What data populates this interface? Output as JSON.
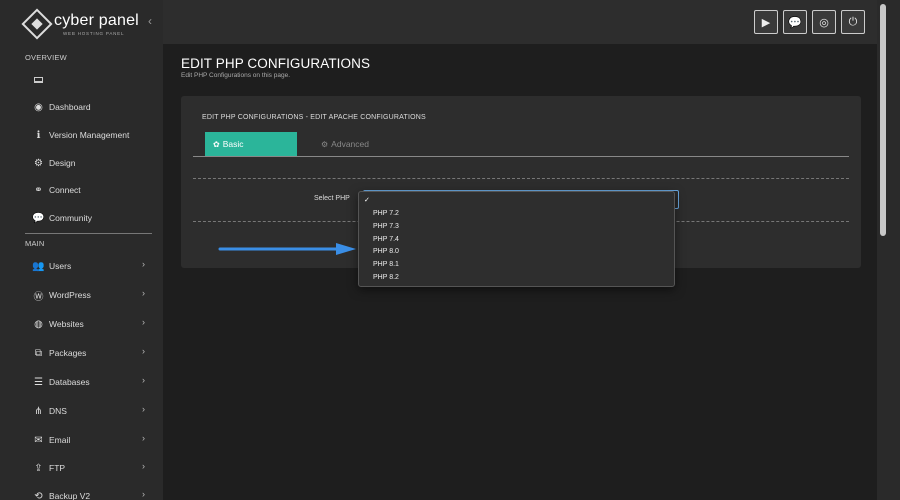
{
  "sidebar": {
    "brand": "cyber panel",
    "brand_sub": "WEB HOSTING PANEL",
    "sections": {
      "overview": "OVERVIEW",
      "main": "MAIN"
    },
    "overview_items": [
      {
        "label": "",
        "icon": "laptop-icon"
      },
      {
        "label": "Dashboard",
        "icon": "dashboard-icon"
      },
      {
        "label": "Version Management",
        "icon": "info-icon"
      },
      {
        "label": "Design",
        "icon": "gear-icon"
      },
      {
        "label": "Connect",
        "icon": "link-icon"
      },
      {
        "label": "Community",
        "icon": "chat-icon"
      }
    ],
    "main_items": [
      {
        "label": "Users",
        "icon": "users-icon"
      },
      {
        "label": "WordPress",
        "icon": "wordpress-icon"
      },
      {
        "label": "Websites",
        "icon": "globe-icon"
      },
      {
        "label": "Packages",
        "icon": "cubes-icon"
      },
      {
        "label": "Databases",
        "icon": "database-icon"
      },
      {
        "label": "DNS",
        "icon": "sitemap-icon"
      },
      {
        "label": "Email",
        "icon": "envelope-icon"
      },
      {
        "label": "FTP",
        "icon": "upload-icon"
      },
      {
        "label": "Backup V2",
        "icon": "backup-icon"
      }
    ]
  },
  "topbar": {
    "buttons": [
      "youtube-icon",
      "chat-bubbles-icon",
      "lifebuoy-icon",
      "power-icon"
    ]
  },
  "page": {
    "title": "EDIT PHP CONFIGURATIONS",
    "subtitle": "Edit PHP Configurations on this page."
  },
  "panel": {
    "title": "EDIT PHP CONFIGURATIONS - EDIT APACHE CONFIGURATIONS",
    "tabs": {
      "basic": "Basic",
      "advanced": "Advanced"
    },
    "select_label": "Select PHP",
    "select_value": "",
    "options": [
      "PHP 7.2",
      "PHP 7.3",
      "PHP 7.4",
      "PHP 8.0",
      "PHP 8.1",
      "PHP 8.2"
    ]
  },
  "colors": {
    "accent": "#2bb59a",
    "arrow": "#3a8ee6",
    "focus": "#6aa8e0"
  }
}
